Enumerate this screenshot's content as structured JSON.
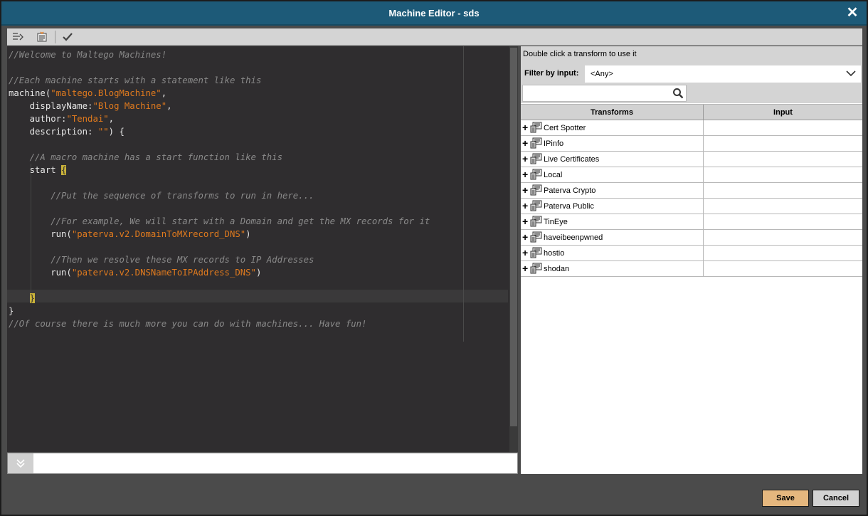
{
  "window": {
    "title": "Machine Editor - sds",
    "close_glyph": "✕"
  },
  "toolbar": {
    "buttons": [
      {
        "icon": "indent-icon"
      },
      {
        "icon": "format-icon"
      },
      {
        "icon": "checkmark-icon"
      }
    ]
  },
  "editor": {
    "lines": [
      [
        {
          "t": "comment",
          "v": "//Welcome to Maltego Machines!"
        }
      ],
      [],
      [
        {
          "t": "comment",
          "v": "//Each machine starts with a statement like this"
        }
      ],
      [
        {
          "t": "plain",
          "v": "machine("
        },
        {
          "t": "string",
          "v": "\"maltego.BlogMachine\""
        },
        {
          "t": "plain",
          "v": ","
        }
      ],
      [
        {
          "t": "plain",
          "v": "    displayName:"
        },
        {
          "t": "string",
          "v": "\"Blog Machine\""
        },
        {
          "t": "plain",
          "v": ","
        }
      ],
      [
        {
          "t": "plain",
          "v": "    author:"
        },
        {
          "t": "string",
          "v": "\"Tendai\""
        },
        {
          "t": "plain",
          "v": ","
        }
      ],
      [
        {
          "t": "plain",
          "v": "    description: "
        },
        {
          "t": "string",
          "v": "\"\""
        },
        {
          "t": "plain",
          "v": ") {"
        }
      ],
      [],
      [
        {
          "t": "comment",
          "v": "    //A macro machine has a start function like this"
        }
      ],
      [
        {
          "t": "plain",
          "v": "    start "
        },
        {
          "t": "brace",
          "v": "{"
        }
      ],
      [],
      [
        {
          "t": "comment",
          "v": "        //Put the sequence of transforms to run in here..."
        }
      ],
      [],
      [
        {
          "t": "comment",
          "v": "        //For example, We will start with a Domain and get the MX records for it"
        }
      ],
      [
        {
          "t": "plain",
          "v": "        run("
        },
        {
          "t": "string",
          "v": "\"paterva.v2.DomainToMXrecord_DNS\""
        },
        {
          "t": "plain",
          "v": ")"
        }
      ],
      [],
      [
        {
          "t": "comment",
          "v": "        //Then we resolve these MX records to IP Addresses"
        }
      ],
      [
        {
          "t": "plain",
          "v": "        run("
        },
        {
          "t": "string",
          "v": "\"paterva.v2.DNSNameToIPAddress_DNS\""
        },
        {
          "t": "plain",
          "v": ")"
        }
      ],
      [],
      [
        {
          "t": "plain",
          "v": "    "
        },
        {
          "t": "brace",
          "v": "}"
        }
      ],
      [
        {
          "t": "plain",
          "v": "}"
        }
      ],
      [
        {
          "t": "comment",
          "v": "//Of course there is much more you can do with machines... Have fun!"
        }
      ]
    ]
  },
  "command_bar": {
    "value": "",
    "placeholder": ""
  },
  "transforms_panel": {
    "hint": "Double click a transform to use it",
    "filter_label": "Filter by input:",
    "filter_value": "<Any>",
    "search_value": "",
    "columns": {
      "transforms": "Transforms",
      "input": "Input"
    },
    "rows": [
      {
        "name": "Cert Spotter",
        "input": ""
      },
      {
        "name": "IPinfo",
        "input": ""
      },
      {
        "name": "Live Certificates",
        "input": ""
      },
      {
        "name": "Local",
        "input": ""
      },
      {
        "name": "Paterva Crypto",
        "input": ""
      },
      {
        "name": "Paterva Public",
        "input": ""
      },
      {
        "name": "TinEye",
        "input": ""
      },
      {
        "name": "haveibeenpwned",
        "input": ""
      },
      {
        "name": "hostio",
        "input": ""
      },
      {
        "name": "shodan",
        "input": ""
      }
    ]
  },
  "footer": {
    "save_label": "Save",
    "cancel_label": "Cancel"
  },
  "colors": {
    "titlebar": "#1d5a78",
    "editor_bg": "#2f2d2f",
    "comment": "#8a8a8a",
    "string": "#e07a1e",
    "save_button": "#e5b77e"
  }
}
